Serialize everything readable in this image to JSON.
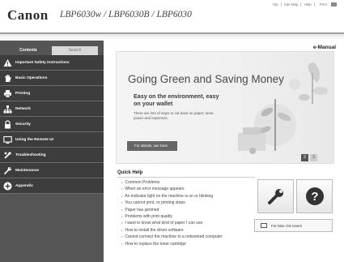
{
  "header": {
    "brand": "Canon",
    "models": "LBP6030w / LBP6030B / LBP6030",
    "links": [
      "Top",
      "Site Map",
      "Help",
      "Print"
    ]
  },
  "sidebar": {
    "tabs": {
      "contents": "Contents",
      "search": "Search"
    },
    "items": [
      {
        "label": "Important Safety Instructions",
        "icon": "warning-icon"
      },
      {
        "label": "Basic Operations",
        "icon": "hand-icon"
      },
      {
        "label": "Printing",
        "icon": "printer-icon"
      },
      {
        "label": "Network",
        "icon": "network-icon"
      },
      {
        "label": "Security",
        "icon": "lock-icon"
      },
      {
        "label": "Using the Remote UI",
        "icon": "monitor-icon"
      },
      {
        "label": "Troubleshooting",
        "icon": "tools-icon"
      },
      {
        "label": "Maintenance",
        "icon": "wrench-icon"
      },
      {
        "label": "Appendix",
        "icon": "plus-circle-icon"
      }
    ]
  },
  "main": {
    "manual_label": "e-Manual",
    "hero": {
      "title": "Going Green and Saving Money",
      "subtitle": "Easy on the environment, easy on your wallet",
      "body": "There are lots of ways to cut back on paper, toner, power and expenses.",
      "button": "For details, see here",
      "pages": [
        "2",
        "3"
      ]
    },
    "quick_help": {
      "title": "Quick Help",
      "items": [
        "Common Problems",
        "When an error message appears",
        "An indicator light on the machine is on or blinking",
        "You cannot print, or printing stops",
        "Paper has jammed",
        "Problems with print quality",
        "I want to know what kind of paper I can use",
        "How to install the driver software",
        "Cannot connect the machine to a networked computer",
        "How to replace the toner cartridge"
      ]
    },
    "mac_button": "For Mac OS Users"
  }
}
